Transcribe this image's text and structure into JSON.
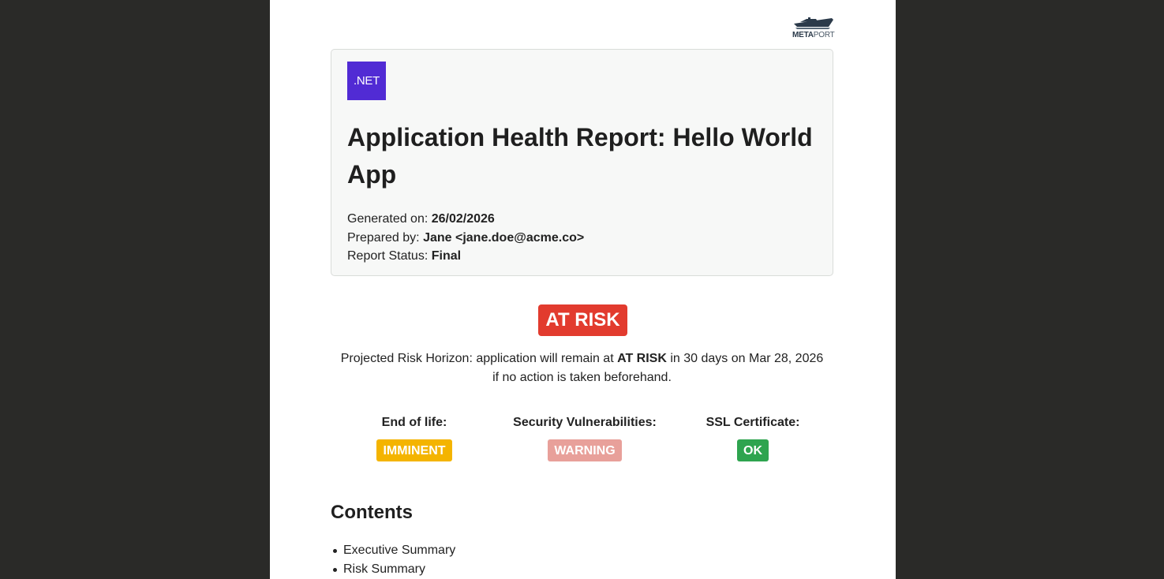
{
  "brand": {
    "logo_bold": "META",
    "logo_light": "PORT",
    "logo_icon": "ship-icon"
  },
  "header": {
    "tech_badge": ".NET",
    "title": "Application Health Report: Hello World App",
    "generated_label": "Generated on:",
    "generated_value": "26/02/2026",
    "prepared_label": "Prepared by:",
    "prepared_value": "Jane <jane.doe@acme.co>",
    "status_label": "Report Status:",
    "status_value": "Final"
  },
  "overall_status": {
    "label": "AT RISK",
    "color": "#e23b2e",
    "horizon_prefix": "Projected Risk Horizon: application will remain at",
    "horizon_status": "AT RISK",
    "horizon_suffix": "in 30 days on Mar 28, 2026",
    "horizon_line2": "if no action is taken beforehand."
  },
  "indicators": [
    {
      "label": "End of life:",
      "status": "IMMINENT",
      "color": "#f4b400"
    },
    {
      "label": "Security Vulnerabilities:",
      "status": "WARNING",
      "color": "#e8a09a"
    },
    {
      "label": "SSL Certificate:",
      "status": "OK",
      "color": "#2ea44f"
    }
  ],
  "contents": {
    "title": "Contents",
    "items": [
      "Executive Summary",
      "Risk Summary"
    ]
  }
}
